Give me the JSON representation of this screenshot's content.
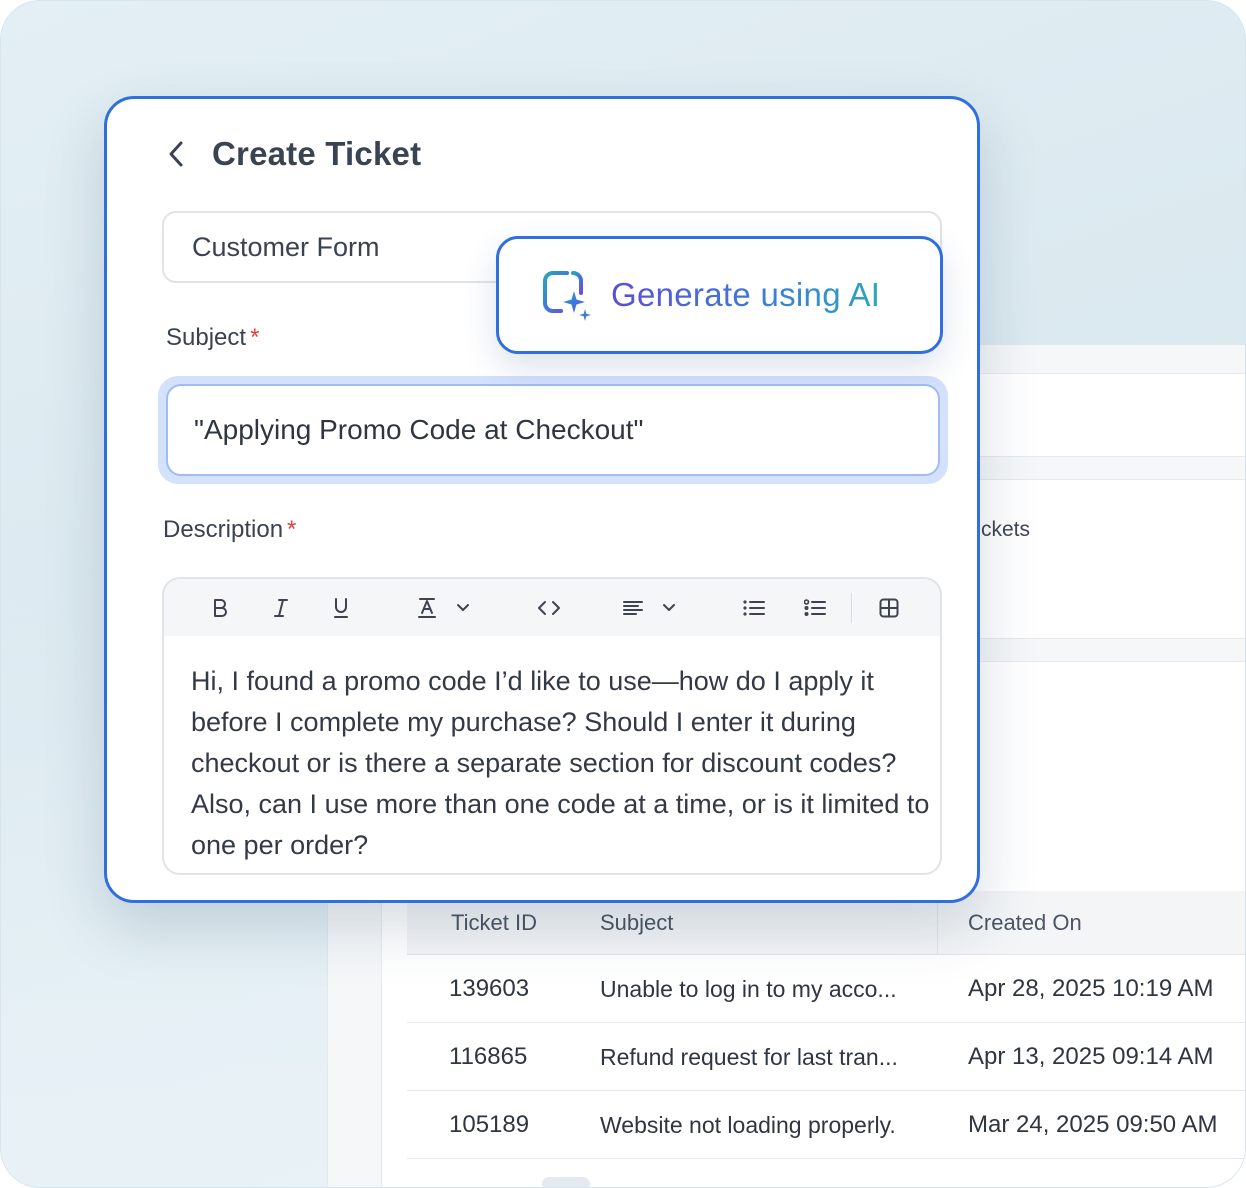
{
  "modal": {
    "title": "Create Ticket",
    "form_select_value": "Customer Form",
    "subject_label": "Subject",
    "subject_required": "*",
    "subject_value": "\"Applying Promo Code at Checkout\"",
    "description_label": "Description",
    "description_required": "*",
    "description_value": "Hi,  I found a promo code I’d like to use—how do I apply it before I complete my purchase? Should I enter it during checkout or is there a separate section for discount codes? Also, can I use more than one code at a time, or is it limited to one per order?",
    "toolbar": [
      "bold-icon",
      "italic-icon",
      "underline-icon",
      "text-color-icon",
      "chevron-down-icon",
      "code-icon",
      "align-icon",
      "chevron-down-icon",
      "bullet-list-icon",
      "numbered-list-icon",
      "table-icon"
    ]
  },
  "ai_button": {
    "label": "Generate using AI",
    "icon": "ai-sparkle-icon",
    "gradient": [
      "#5b4fd8",
      "#3d7ad8",
      "#2aa7b8"
    ]
  },
  "background": {
    "tickets_label_partial": "ckets",
    "table": {
      "columns": [
        "Ticket ID",
        "Subject",
        "Created On"
      ],
      "rows": [
        {
          "id": "139603",
          "subject": "Unable to log in to my acco...",
          "created": "Apr 28, 2025 10:19 AM"
        },
        {
          "id": "116865",
          "subject": "Refund request for last tran...",
          "created": "Apr 13, 2025 09:14 AM"
        },
        {
          "id": "105189",
          "subject": "Website not loading properly.",
          "created": "Mar 24, 2025 09:50 AM"
        }
      ]
    }
  },
  "colors": {
    "accent": "#2f6fe0",
    "required": "#e0433a",
    "focus_ring": "#d3e1fb"
  }
}
